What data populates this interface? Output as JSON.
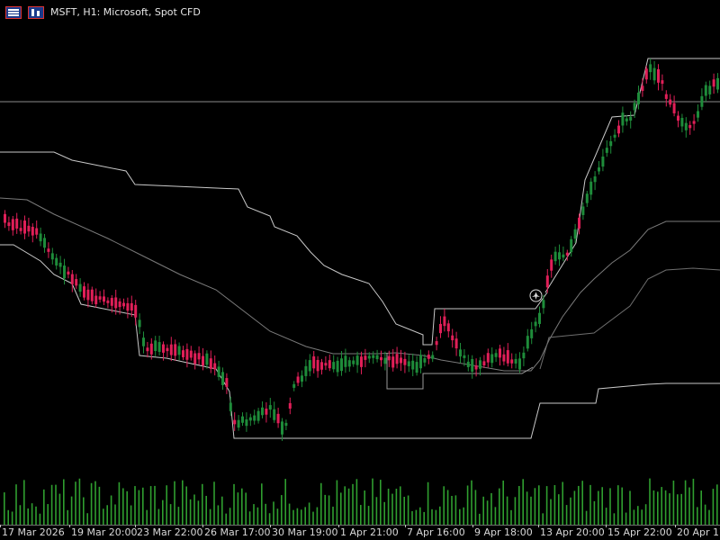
{
  "header": {
    "title": "MSFT, H1:  Microsoft, Spot CFD",
    "icons": [
      "one-click-trading-icon",
      "chart-type-icon"
    ]
  },
  "colors": {
    "background": "#000000",
    "bull_candle": "#1e8c3a",
    "bear_candle": "#e01f58",
    "indicator_line": "#c8c8c8",
    "horizontal_level": "#8a8a8a",
    "volume": "#2f9e2f",
    "text": "#e8e8e8"
  },
  "xaxis_labels": [
    "17 Mar 2026",
    "19 Mar 20:00",
    "23 Mar 22:00",
    "26 Mar 17:00",
    "30 Mar 19:00",
    "1 Apr 21:00",
    "7 Apr 16:00",
    "9 Apr 18:00",
    "13 Apr 20:00",
    "15 Apr 22:00",
    "20 Apr 17:..."
  ],
  "trade_icon": "trade-marker-icon",
  "chart_data": {
    "type": "candlestick",
    "symbol": "MSFT",
    "timeframe": "H1",
    "volume_shown": true
  }
}
